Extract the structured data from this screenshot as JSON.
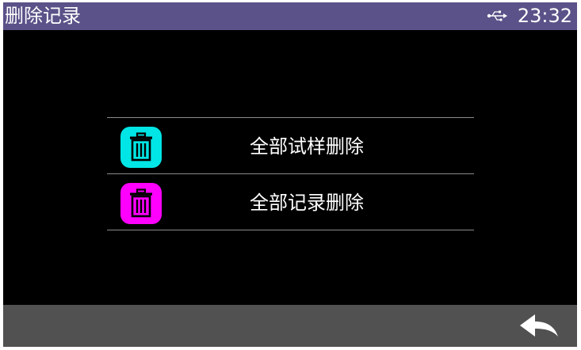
{
  "header": {
    "title": "删除记录",
    "time": "23:32",
    "status_icon": "usb-icon"
  },
  "menu": {
    "items": [
      {
        "label": "全部试样删除",
        "icon": "trash-icon",
        "icon_color": "#00e5e5"
      },
      {
        "label": "全部记录删除",
        "icon": "trash-icon",
        "icon_color": "#ff00ff"
      }
    ]
  },
  "footer": {
    "back_icon": "back-arrow-icon"
  },
  "colors": {
    "title_bar": "#5a5288",
    "background": "#000000",
    "bottom_bar": "#515151"
  }
}
